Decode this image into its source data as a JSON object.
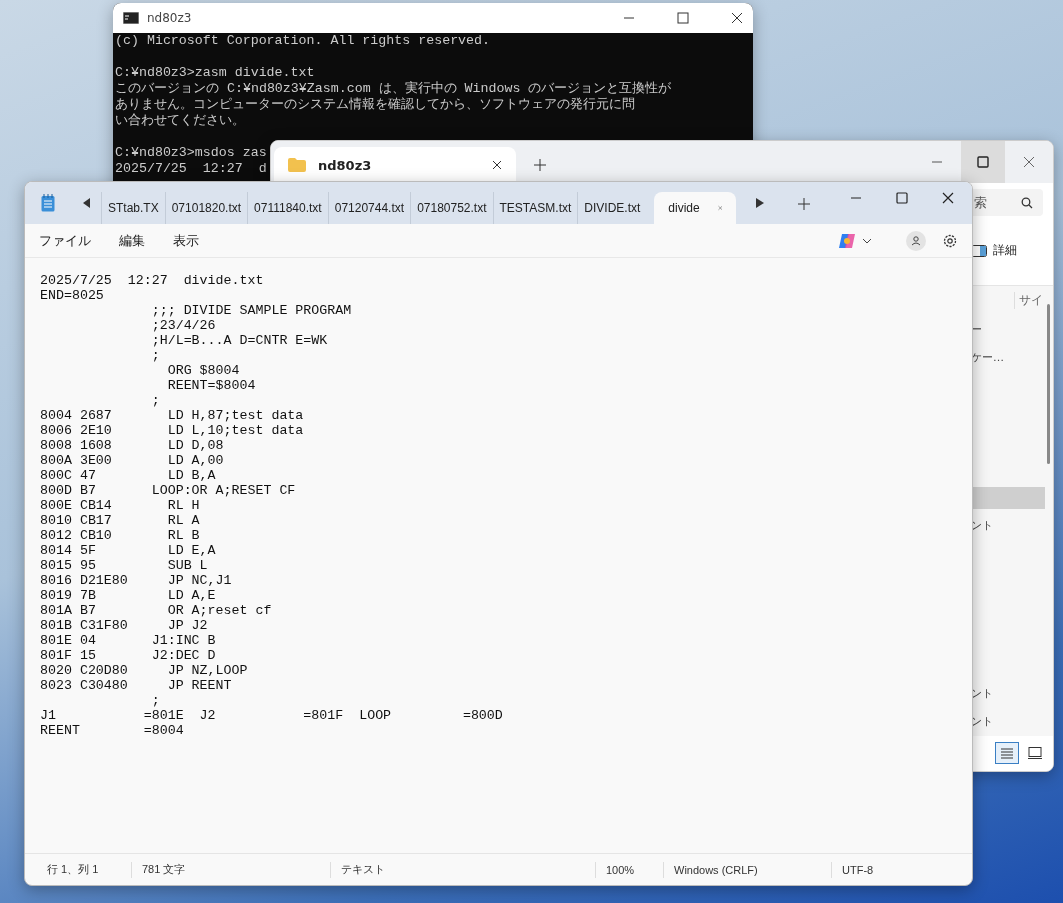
{
  "console": {
    "title": "nd80z3",
    "blocks": [
      [
        "(c) Microsoft Corporation. All rights reserved."
      ],
      [
        "C:¥nd80z3>zasm divide.txt",
        "このバージョンの C:¥nd80z3¥Zasm.com は、実行中の Windows のバージョンと互換性が",
        "ありません。コンピューターのシステム情報を確認してから、ソフトウェアの発行元に問",
        "い合わせてください。"
      ],
      [
        "C:¥nd80z3>msdos zas",
        "2025/7/25  12:27  d"
      ]
    ]
  },
  "explorer": {
    "tab": {
      "label": "nd80z3",
      "selected": true
    },
    "search": {
      "placeholder": "索"
    },
    "details_button": "詳細",
    "column_1": "サイ",
    "rows": [
      {
        "text": "ー",
        "selected": false
      },
      {
        "text": "ケー…",
        "selected": false
      },
      {
        "selected": true
      },
      {
        "text": "ント",
        "selected": false
      },
      {
        "text": "ント",
        "selected": false
      },
      {
        "text": "ント",
        "selected": false
      }
    ],
    "views": [
      {
        "kind": "details",
        "selected": true
      },
      {
        "kind": "tiles",
        "selected": false
      }
    ]
  },
  "notepad": {
    "tabs": [
      {
        "label": "STtab.TX",
        "selected": false
      },
      {
        "label": "07101820.txt",
        "selected": false
      },
      {
        "label": "07111840.txt",
        "selected": false
      },
      {
        "label": "07120744.txt",
        "selected": false
      },
      {
        "label": "07180752.txt",
        "selected": false
      },
      {
        "label": "TESTASM.txt",
        "selected": false
      },
      {
        "label": "DIVIDE.txt",
        "selected": false
      },
      {
        "label": "divide",
        "selected": true
      }
    ],
    "menu": [
      "ファイル",
      "編集",
      "表示"
    ],
    "lines": [
      "2025/7/25  12:27  divide.txt",
      "END=8025",
      "              ;;; DIVIDE SAMPLE PROGRAM",
      "              ;23/4/26",
      "              ;H/L=B...A D=CNTR E=WK",
      "              ;",
      "                ORG $8004",
      "                REENT=$8004",
      "              ;",
      "8004 2687       LD H,87;test data",
      "8006 2E10       LD L,10;test data",
      "8008 1608       LD D,08",
      "800A 3E00       LD A,00",
      "800C 47         LD B,A",
      "800D B7       LOOP:OR A;RESET CF",
      "800E CB14       RL H",
      "8010 CB17       RL A",
      "8012 CB10       RL B",
      "8014 5F         LD E,A",
      "8015 95         SUB L",
      "8016 D21E80     JP NC,J1",
      "8019 7B         LD A,E",
      "801A B7         OR A;reset cf",
      "801B C31F80     JP J2",
      "801E 04       J1:INC B",
      "801F 15       J2:DEC D",
      "8020 C20D80     JP NZ,LOOP",
      "8023 C30480     JP REENT",
      "              ;",
      "J1           =801E  J2           =801F  LOOP         =800D",
      "REENT        =8004"
    ],
    "status": [
      "行 1、列 1",
      "781 文字",
      "テキスト",
      "100%",
      "Windows (CRLF)",
      "UTF-8"
    ]
  }
}
